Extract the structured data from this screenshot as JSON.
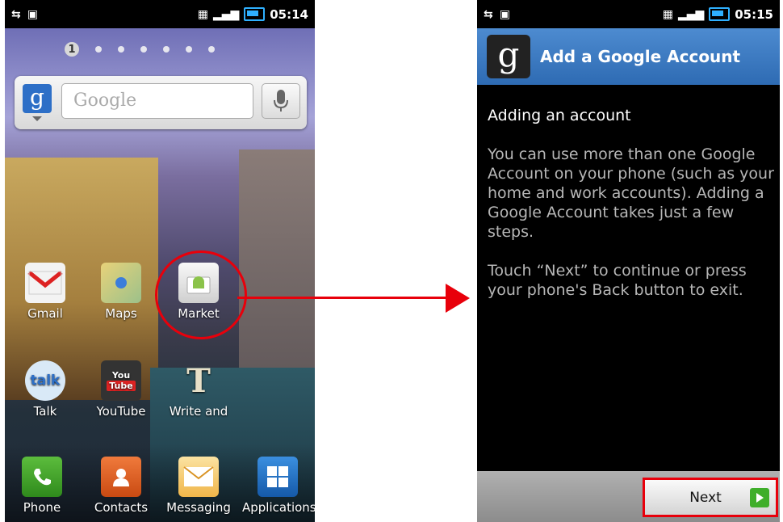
{
  "left_screen": {
    "status_time": "05:14",
    "page_indicator_current": "1",
    "page_count": 7,
    "search_placeholder": "Google",
    "apps": [
      {
        "label": "Gmail",
        "icon": "gmail-icon"
      },
      {
        "label": "Maps",
        "icon": "maps-icon"
      },
      {
        "label": "Market",
        "icon": "market-icon"
      },
      {
        "label": "Talk",
        "icon": "talk-icon",
        "icon_text": "talk"
      },
      {
        "label": "YouTube",
        "icon": "youtube-icon",
        "icon_text_top": "You",
        "icon_text_bottom": "Tube"
      },
      {
        "label": "Write and",
        "icon": "write-and-icon",
        "icon_text": "T"
      }
    ],
    "dock": [
      {
        "label": "Phone",
        "icon": "phone-icon"
      },
      {
        "label": "Contacts",
        "icon": "contacts-icon"
      },
      {
        "label": "Messaging",
        "icon": "messaging-icon"
      },
      {
        "label": "Applications",
        "icon": "applications-icon"
      }
    ]
  },
  "right_screen": {
    "status_time": "05:15",
    "title": "Add a Google Account",
    "heading": "Adding an account",
    "body": "You can use more than one Google Account on your phone (such as your home and work accounts). Adding a Google Account takes just a few steps.\n\nTouch “Next” to continue or press your phone's Back button to exit.",
    "next_label": "Next"
  },
  "colors": {
    "highlight": "#e8000b",
    "titlebar": "#3a78c0",
    "next_arrow": "#3fae2a"
  }
}
